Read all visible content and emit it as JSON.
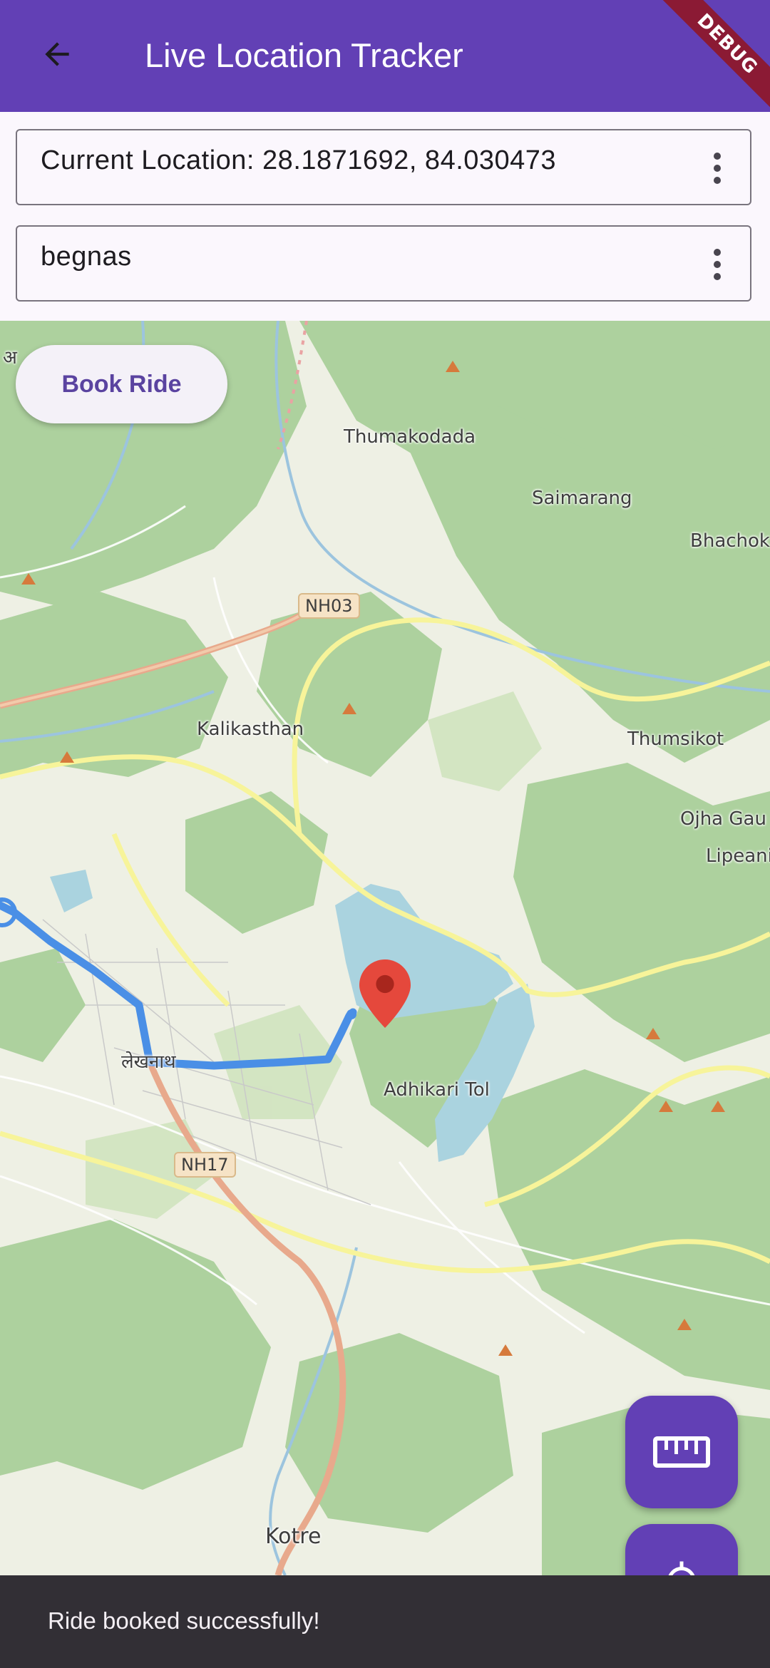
{
  "appbar": {
    "title": "Live Location Tracker",
    "debug_label": "DEBUG"
  },
  "fields": {
    "current_location": "Current Location: 28.1871692, 84.030473",
    "destination": "begnas"
  },
  "map": {
    "place_labels": {
      "thumakodada": "Thumakodada",
      "saimarang": "Saimarang",
      "bhachok": "Bhachok",
      "kalikasthan": "Kalikasthan",
      "thumsikot": "Thumsikot",
      "ojha_gau": "Ojha Gau",
      "lipeani": "Lipeani",
      "adhikari_tol": "Adhikari Tol",
      "lekhnath": "लेखनाथ",
      "kotre": "Kotre",
      "top_left_fragment": "अ"
    },
    "road_shields": {
      "nh03": "NH03",
      "nh17": "NH17"
    },
    "colors": {
      "route": "#4a8fe6",
      "marker": "#e5483c",
      "water": "#aad3df",
      "forest": "#add19e"
    }
  },
  "book_ride_button": "Book Ride",
  "fab": {
    "ruler_icon": "ruler-icon",
    "locate_icon": "my-location-icon"
  },
  "snackbar": {
    "message": "Ride booked successfully!"
  }
}
